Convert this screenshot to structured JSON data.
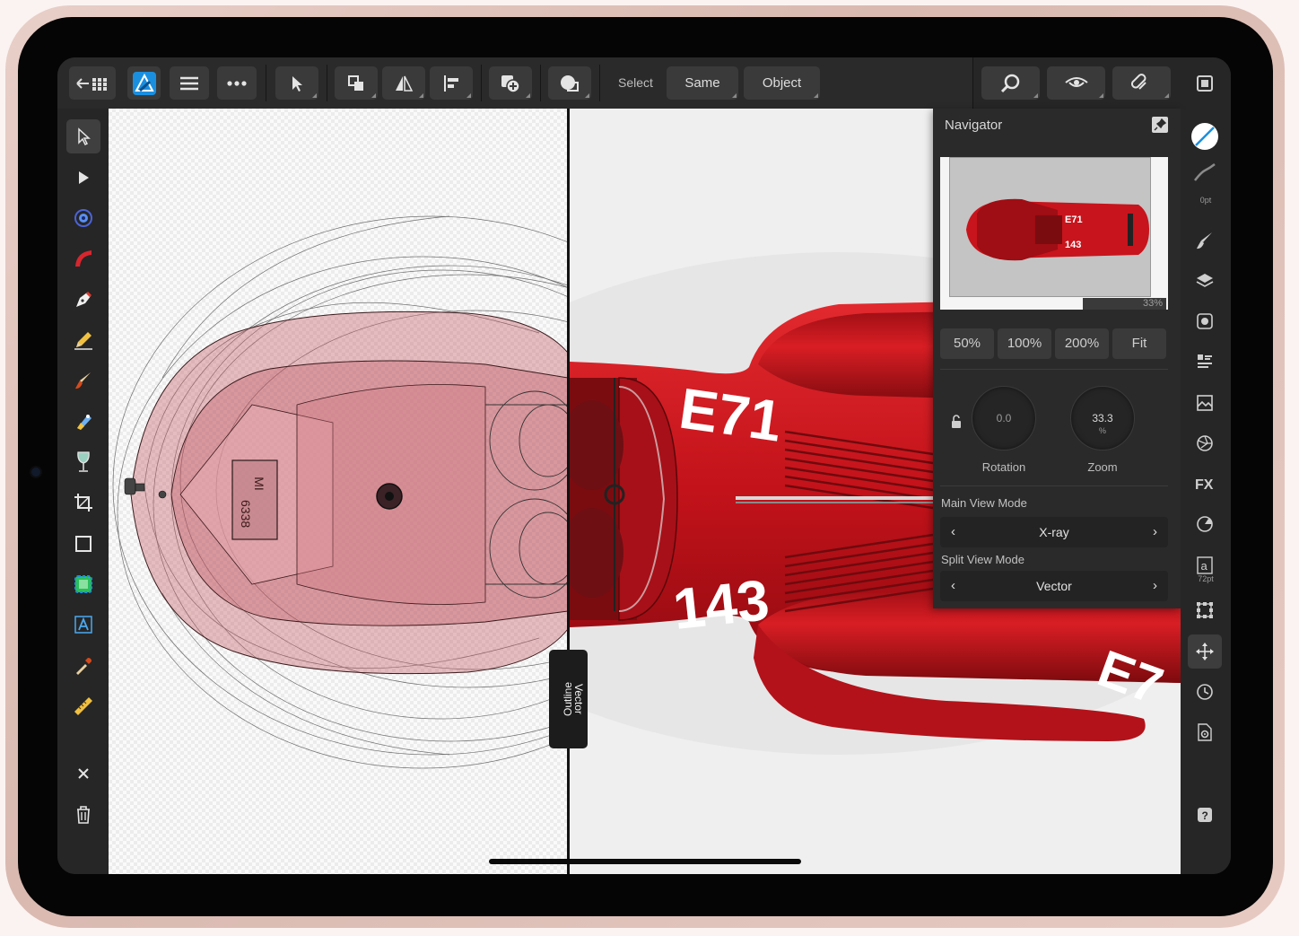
{
  "toolbar": {
    "select_label": "Select",
    "same_label": "Same",
    "object_label": "Object"
  },
  "split_view": {
    "left_mode": "Outline",
    "right_mode": "Vector"
  },
  "navigator": {
    "title": "Navigator",
    "thumbnail_zoom": "33%",
    "zoom_presets": [
      "50%",
      "100%",
      "200%",
      "Fit"
    ],
    "rotation": {
      "value": "0.0",
      "label": "Rotation"
    },
    "zoom": {
      "value": "33.3",
      "unit": "%",
      "label": "Zoom"
    },
    "main_view_mode": {
      "label": "Main View Mode",
      "value": "X-ray"
    },
    "split_view_mode": {
      "label": "Split View Mode",
      "value": "Vector"
    }
  },
  "studio": {
    "stroke_width_label": "0pt",
    "text_size_label": "72pt"
  },
  "car": {
    "number_top": "E71",
    "number_bottom": "143",
    "number_tail": "E7",
    "plate_line1": "MI",
    "plate_line2": "6338"
  },
  "colors": {
    "accent_blue": "#1a8fe0",
    "car_red": "#c8141c",
    "canvas_right_bg": "#efefef"
  }
}
